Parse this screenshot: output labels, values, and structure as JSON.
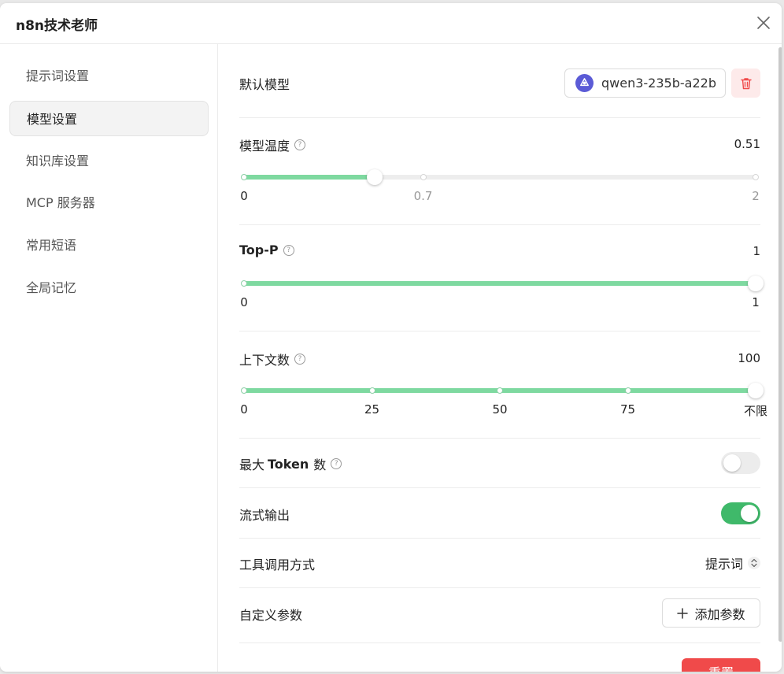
{
  "dialog": {
    "title": "n8n技术老师",
    "close_icon": "close-icon"
  },
  "sidebar": {
    "items": [
      {
        "label": "提示词设置"
      },
      {
        "label": "模型设置",
        "active": true
      },
      {
        "label": "知识库设置"
      },
      {
        "label": "MCP 服务器"
      },
      {
        "label": "常用短语"
      },
      {
        "label": "全局记忆"
      }
    ]
  },
  "settings": {
    "default_model": {
      "label": "默认模型",
      "model_name": "qwen3-235b-a22b",
      "model_icon": "model-logo-icon",
      "delete_icon": "trash-icon"
    },
    "temperature": {
      "label": "模型温度",
      "value": "0.51",
      "value_numeric": 0.51,
      "min": 0,
      "max": 2,
      "ticks": [
        {
          "label": "0",
          "value": 0
        },
        {
          "label": "0.7",
          "value": 0.7
        },
        {
          "label": "2",
          "value": 2
        }
      ]
    },
    "top_p": {
      "label": "Top-P",
      "value": "1",
      "value_numeric": 1,
      "min": 0,
      "max": 1,
      "ticks": [
        {
          "label": "0",
          "value": 0
        },
        {
          "label": "1",
          "value": 1
        }
      ]
    },
    "context_count": {
      "label": "上下文数",
      "value": "100",
      "value_fraction": 1.0,
      "ticks": [
        {
          "label": "0",
          "fraction": 0
        },
        {
          "label": "25",
          "fraction": 0.25
        },
        {
          "label": "50",
          "fraction": 0.5
        },
        {
          "label": "75",
          "fraction": 0.75
        },
        {
          "label": "不限",
          "fraction": 1
        }
      ]
    },
    "max_tokens": {
      "label_prefix": "最大",
      "label_bold": "Token",
      "label_suffix": "数",
      "enabled": false
    },
    "stream_output": {
      "label": "流式输出",
      "enabled": true
    },
    "tool_call_mode": {
      "label": "工具调用方式",
      "value": "提示词"
    },
    "custom_params": {
      "label": "自定义参数",
      "add_button": "添加参数"
    },
    "reset_button": "重置"
  },
  "colors": {
    "accent_green": "#3fb96a",
    "slider_fill": "#7ed9a0",
    "danger": "#f04a4a",
    "model_logo": "#5b5bd6"
  }
}
